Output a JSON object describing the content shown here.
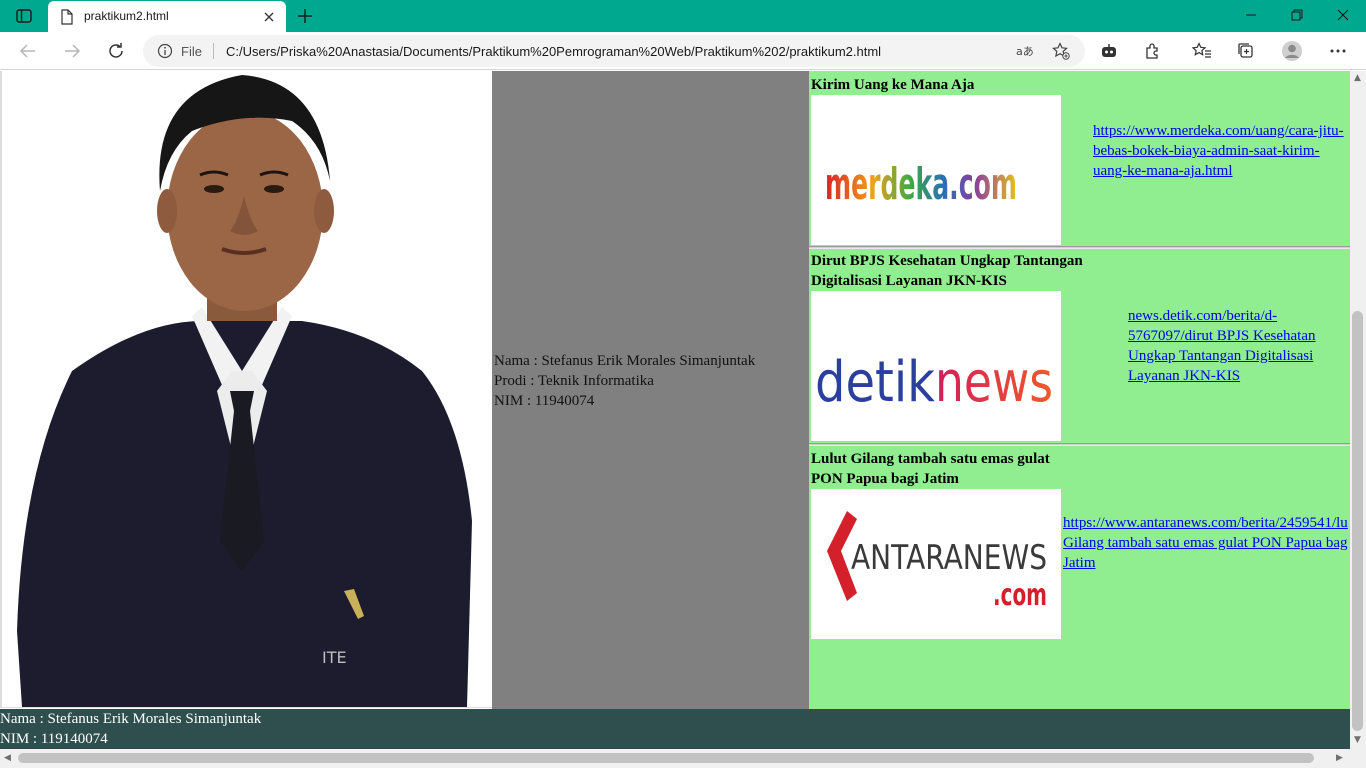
{
  "browser": {
    "tab_title": "praktikum2.html",
    "address_scheme_label": "File",
    "address_url": "C:/Users/Priska%20Anastasia/Documents/Praktikum%20Pemrograman%20Web/Praktikum%202/praktikum2.html",
    "accent_color": "#00a88f"
  },
  "profile": {
    "name_line": "Nama : Stefanus Erik Morales Simanjuntak",
    "prodi_line": "Prodi : Teknik Informatika",
    "nim_line": "NIM : 11940074"
  },
  "news": [
    {
      "title_lines": [
        "Kirim Uang ke Mana Aja"
      ],
      "logo_text": "merdeka.com",
      "link_lines": [
        "https://www.merdeka.com/uang/cara-jitu-",
        "bebas-bokek-biaya-admin-saat-kirim-",
        "uang-ke-mana-aja.html"
      ]
    },
    {
      "title_lines": [
        "Dirut BPJS Kesehatan Ungkap Tantangan",
        "Digitalisasi Layanan JKN-KIS"
      ],
      "logo_text_a": "detik",
      "logo_text_b": "news",
      "link_lines": [
        "news.detik.com/berita/d-",
        "5767097/dirut BPJS Kesehatan",
        "Ungkap Tantangan Digitalisasi",
        "Layanan JKN-KIS"
      ]
    },
    {
      "title_lines": [
        "Lulut Gilang tambah satu emas gulat",
        "PON Papua bagi Jatim"
      ],
      "logo_text_a": "ANTARANEWS",
      "logo_text_b": ".com",
      "link_lines": [
        "https://www.antaranews.com/berita/2459541/lu",
        "Gilang tambah satu emas gulat PON Papua bag",
        "Jatim"
      ]
    }
  ],
  "footer": {
    "name_line": "Nama : Stefanus Erik Morales Simanjuntak",
    "nim_line": "NIM : 119140074"
  },
  "icons": [
    "tab-actions-icon",
    "file-icon",
    "close-icon",
    "plus-icon",
    "minimize-icon",
    "restore-icon",
    "window-close-icon",
    "back-icon",
    "forward-icon",
    "refresh-icon",
    "info-icon",
    "read-aloud-icon",
    "favorite-add-icon",
    "extension-bot-icon",
    "extensions-icon",
    "favorites-icon",
    "collections-icon",
    "profile-icon",
    "more-icon"
  ]
}
